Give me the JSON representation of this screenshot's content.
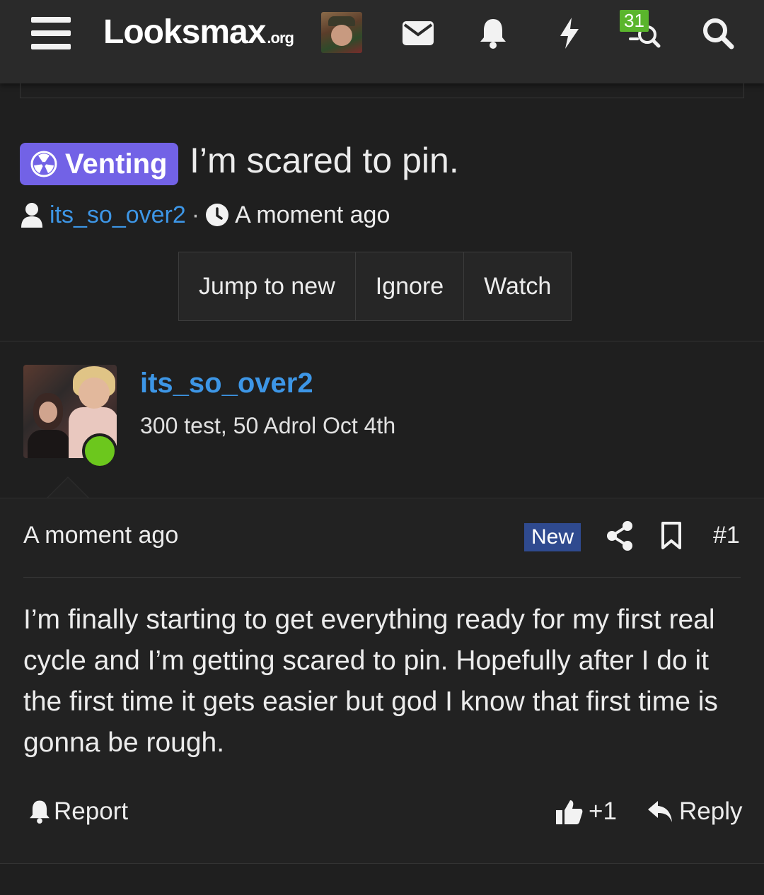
{
  "header": {
    "logo_main": "Looksmax",
    "logo_suffix": ".org",
    "alerts_badge": "31",
    "icons": [
      "menu-icon",
      "envelope-icon",
      "bell-icon",
      "bolt-icon",
      "chat-search-icon",
      "search-icon"
    ]
  },
  "thread": {
    "prefix": "Venting",
    "prefix_color": "#7262e6",
    "title": "I’m scared to pin.",
    "author": "its_so_over2",
    "time": "A moment ago",
    "buttons": {
      "jump": "Jump to new",
      "ignore": "Ignore",
      "watch": "Watch"
    }
  },
  "post": {
    "username": "its_so_over2",
    "user_title": "300 test, 50 Adrol Oct 4th",
    "time": "A moment ago",
    "new_label": "New",
    "number": "#1",
    "content": "I’m finally starting to get everything ready for my first real cycle and I’m getting scared to pin. Hopefully after I do it the first time it gets easier but god I know that first time is gonna be rough.",
    "report_label": "Report",
    "like_label": "+1",
    "reply_label": "Reply"
  },
  "colors": {
    "background": "#1f1f1f",
    "header": "#2a2a2a",
    "link": "#3d96e6",
    "online": "#6cc71d",
    "badge": "#5ab52c",
    "new_badge": "#2f4a8f"
  }
}
